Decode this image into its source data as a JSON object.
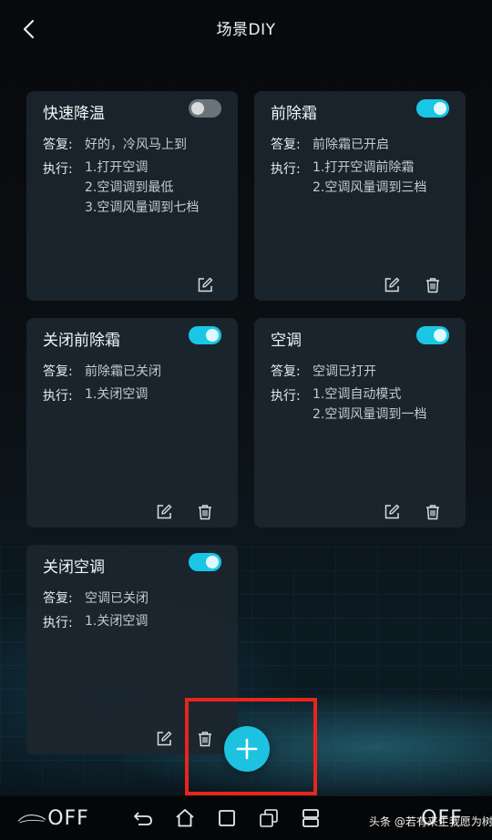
{
  "header": {
    "title": "场景DIY"
  },
  "labels": {
    "reply": "答复:",
    "execute": "执行:"
  },
  "cards": [
    {
      "title": "快速降温",
      "enabled": false,
      "reply": "好的，冷风马上到",
      "steps": [
        "1.打开空调",
        "2.空调调到最低",
        "3.空调风量调到七档"
      ],
      "has_delete": false
    },
    {
      "title": "前除霜",
      "enabled": true,
      "reply": "前除霜已开启",
      "steps": [
        "1.打开空调前除霜",
        "2.空调风量调到三档"
      ],
      "has_delete": true
    },
    {
      "title": "关闭前除霜",
      "enabled": true,
      "reply": "前除霜已关闭",
      "steps": [
        "1.关闭空调"
      ],
      "has_delete": true
    },
    {
      "title": "空调",
      "enabled": true,
      "reply": "空调已打开",
      "steps": [
        "1.空调自动模式",
        "2.空调风量调到一档"
      ],
      "has_delete": true
    },
    {
      "title": "关闭空调",
      "enabled": true,
      "reply": "空调已关闭",
      "steps": [
        "1.关闭空调"
      ],
      "has_delete": true
    }
  ],
  "icons": {
    "back": "chevron-left-icon",
    "edit": "edit-icon",
    "delete": "trash-icon",
    "add": "plus-icon"
  },
  "system_bar": {
    "left_label": "OFF",
    "right_label": "OFF",
    "watermark": "头条 @若有来生我愿为树"
  },
  "colors": {
    "accent": "#1cc2e0",
    "toggle_off": "#6b7278",
    "highlight": "#e8251b",
    "card_bg": "#1c262e"
  }
}
